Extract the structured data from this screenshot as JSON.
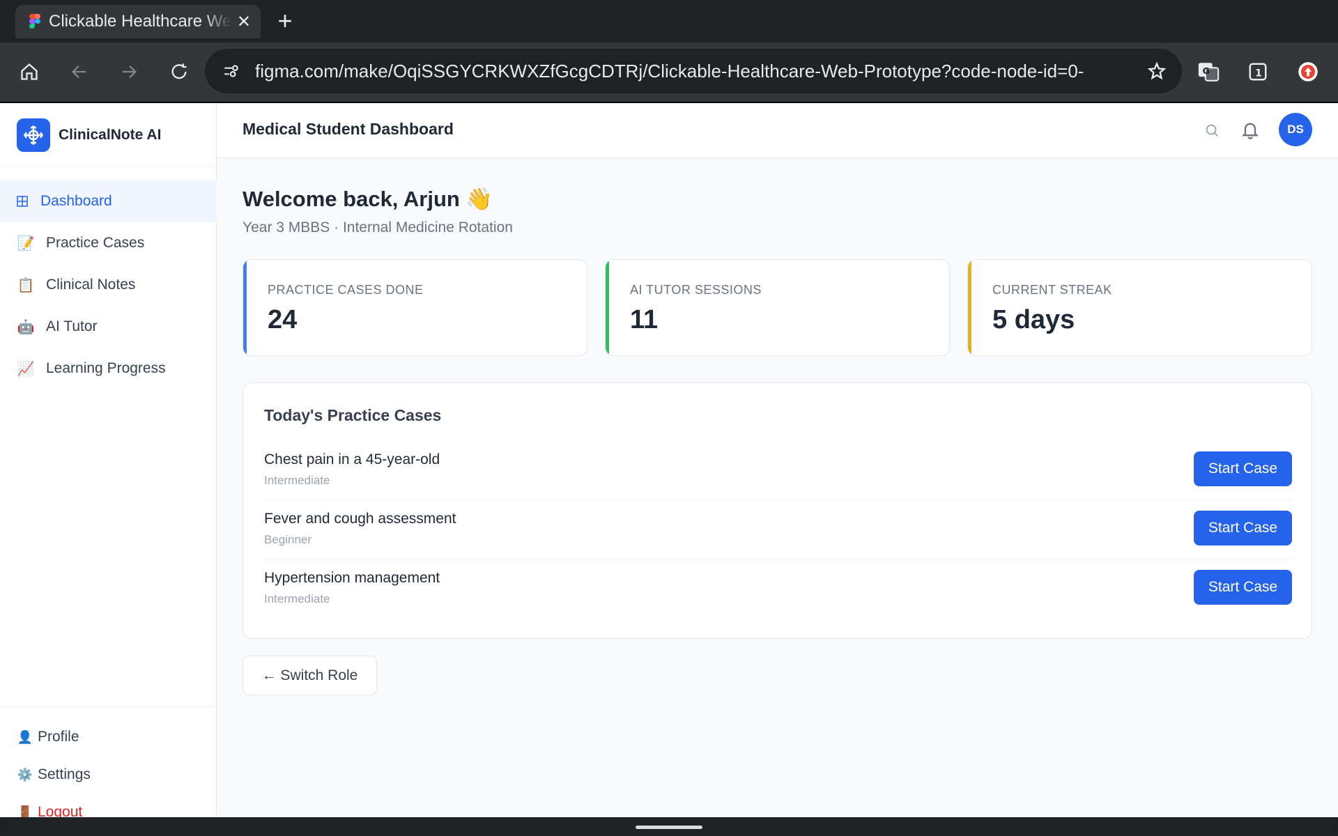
{
  "browser": {
    "tab_title": "Clickable Healthcare We",
    "close_icon": "close-icon",
    "new_tab_icon": "plus-icon",
    "url": "figma.com/make/OqiSSGYCRKWXZfGcgCDTRj/Clickable-Healthcare-Web-Prototype?code-node-id=0-",
    "toolbar_icons": [
      "home-icon",
      "back-icon",
      "forward-icon",
      "reload-icon",
      "site-settings-icon",
      "bookmark-star-icon",
      "translate-icon",
      "tab-count-icon",
      "update-icon"
    ],
    "tab_count": "1"
  },
  "sidebar": {
    "brand": "ClinicalNote AI",
    "items": [
      {
        "label": "Dashboard",
        "icon": "grid-icon",
        "active": true
      },
      {
        "label": "Practice Cases",
        "icon": "memo-icon"
      },
      {
        "label": "Clinical Notes",
        "icon": "notebook-icon"
      },
      {
        "label": "AI Tutor",
        "icon": "robot-icon"
      },
      {
        "label": "Learning Progress",
        "icon": "chart-increasing-icon"
      }
    ],
    "bottom": [
      {
        "label": "Profile",
        "icon": "person-icon"
      },
      {
        "label": "Settings",
        "icon": "gear-icon"
      },
      {
        "label": "Logout",
        "icon": "door-icon"
      }
    ]
  },
  "header": {
    "title": "Medical Student Dashboard",
    "avatar_initials": "DS"
  },
  "main": {
    "welcome": "Welcome back, Arjun 👋",
    "subtitle": "Year 3 MBBS · Internal Medicine Rotation",
    "stats": [
      {
        "label": "PRACTICE CASES DONE",
        "value": "24",
        "color": "#3b82f6"
      },
      {
        "label": "AI TUTOR SESSIONS",
        "value": "11",
        "color": "#22c55e"
      },
      {
        "label": "CURRENT STREAK",
        "value": "5 days",
        "color": "#eab308"
      }
    ],
    "cases_title": "Today's Practice Cases",
    "cases": [
      {
        "name": "Chest pain in a 45-year-old",
        "level": "Intermediate",
        "button": "Start Case"
      },
      {
        "name": "Fever and cough assessment",
        "level": "Beginner",
        "button": "Start Case"
      },
      {
        "name": "Hypertension management",
        "level": "Intermediate",
        "button": "Start Case"
      }
    ],
    "switch_role": "← Switch Role"
  },
  "colors": {
    "accent": "#2563eb",
    "logout": "#dc2626"
  }
}
